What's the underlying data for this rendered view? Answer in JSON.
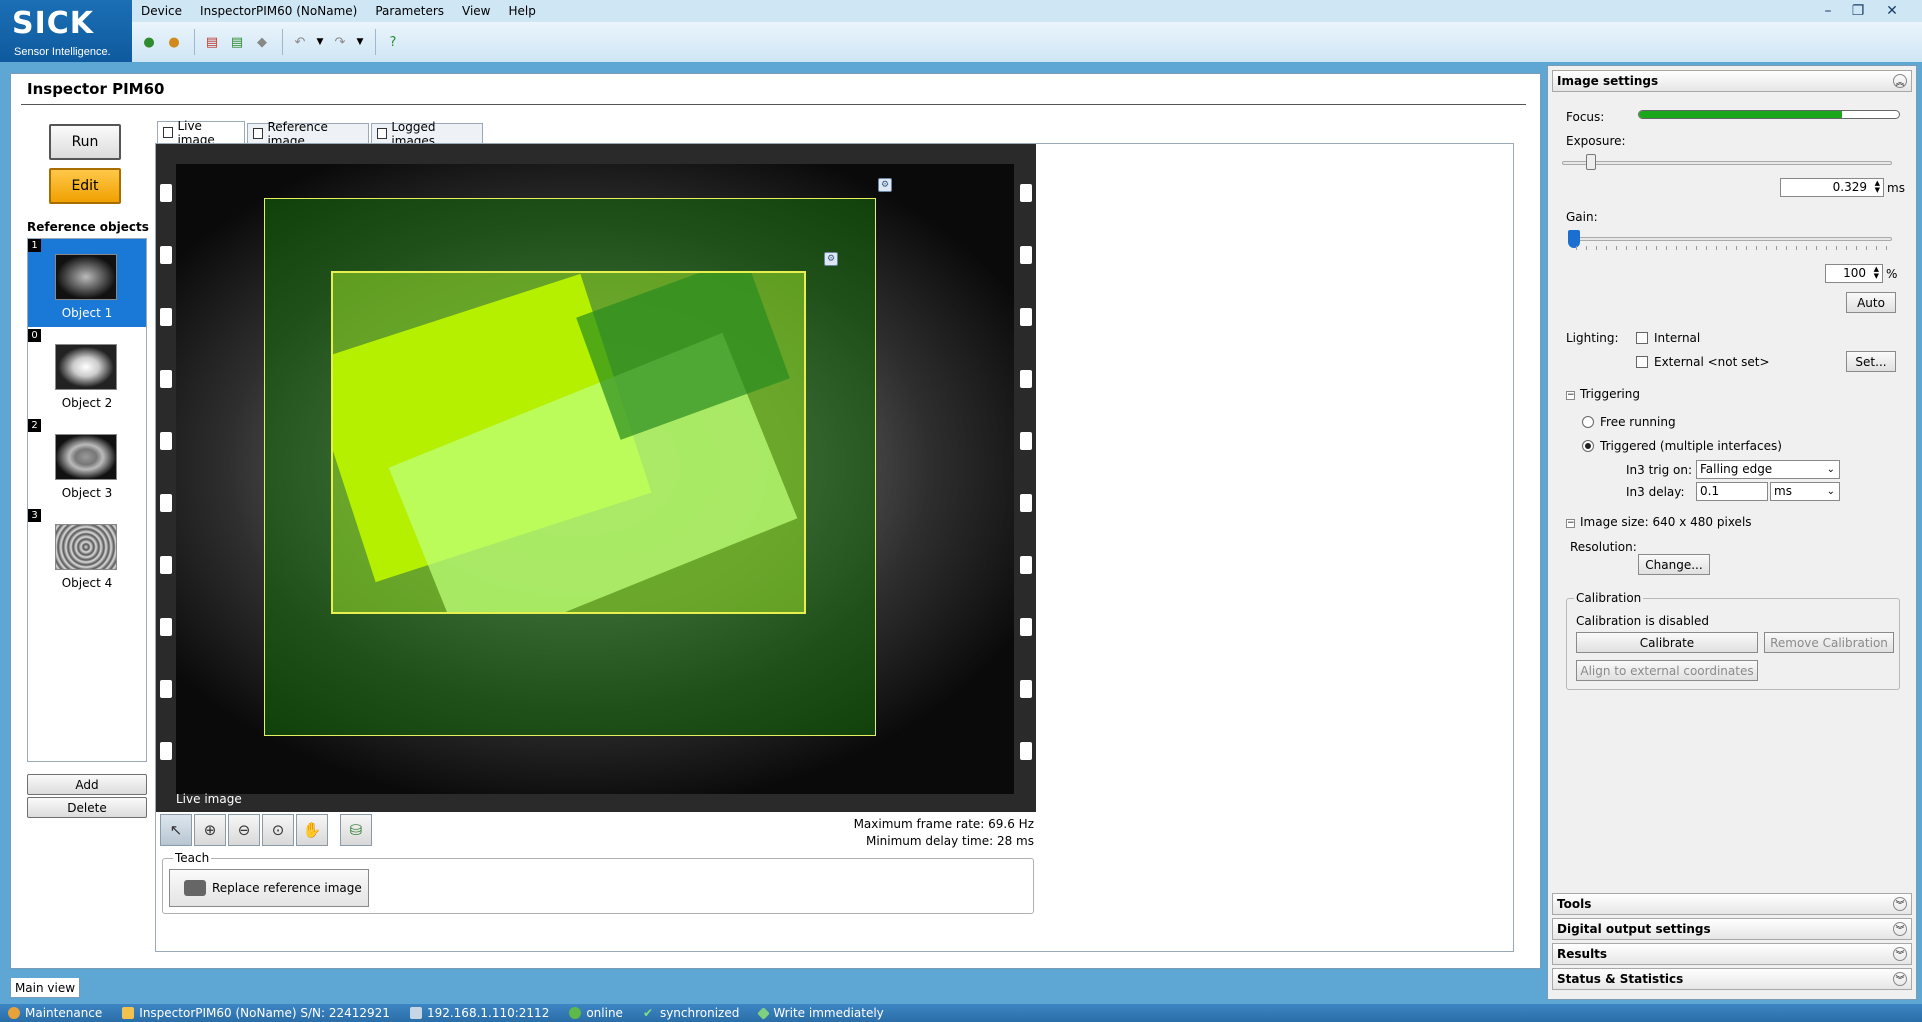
{
  "logo": {
    "brand": "SICK",
    "tagline": "Sensor Intelligence."
  },
  "menu": {
    "items": [
      "Device",
      "InspectorPIM60 (NoName)",
      "Parameters",
      "View",
      "Help"
    ]
  },
  "toolbar": {
    "icons": [
      "connect-icon",
      "disconnect-icon",
      "save-icon",
      "export-icon",
      "eraser-icon",
      "undo-icon",
      "dropdown-icon",
      "redo-icon",
      "dropdown-icon",
      "help-icon"
    ]
  },
  "window": {
    "minimize": "–",
    "restore": "❐",
    "close": "✕"
  },
  "main": {
    "title": "Inspector PIM60",
    "run_label": "Run",
    "edit_label": "Edit",
    "reference_header": "Reference objects",
    "objects": [
      {
        "num": "1",
        "label": "Object 1",
        "selected": true
      },
      {
        "num": "0",
        "label": "Object 2",
        "selected": false
      },
      {
        "num": "2",
        "label": "Object 3",
        "selected": false
      },
      {
        "num": "3",
        "label": "Object 4",
        "selected": false
      }
    ],
    "add_label": "Add",
    "delete_label": "Delete",
    "tabs": [
      "Live image",
      "Reference image",
      "Logged images"
    ],
    "image_caption": "Live image",
    "frame_rate": "Maximum frame rate: 69.6 Hz",
    "min_delay": "Minimum delay time: 28 ms",
    "teach_label": "Teach",
    "replace_label": "Replace reference image",
    "main_view_tab": "Main view"
  },
  "image_settings": {
    "header": "Image settings",
    "focus_label": "Focus:",
    "focus_level": 0.78,
    "exposure_label": "Exposure:",
    "exposure_value": "0.329",
    "exposure_unit": "ms",
    "gain_label": "Gain:",
    "gain_value": "100",
    "gain_unit": "%",
    "auto_label": "Auto",
    "lighting_label": "Lighting:",
    "internal_label": "Internal",
    "external_label": "External <not set>",
    "set_label": "Set...",
    "triggering_label": "Triggering",
    "free_running_label": "Free running",
    "triggered_label": "Triggered (multiple interfaces)",
    "trig_on_label": "In3 trig on:",
    "trig_on_value": "Falling edge",
    "delay_label": "In3 delay:",
    "delay_value": "0.1",
    "delay_unit": "ms",
    "image_size_label": "Image size: 640 x 480 pixels",
    "resolution_label": "Resolution:",
    "change_label": "Change...",
    "calibration_group": "Calibration",
    "calibration_status": "Calibration is disabled",
    "calibrate_label": "Calibrate",
    "remove_calibration_label": "Remove Calibration",
    "align_label": "Align to external coordinates"
  },
  "collapsed_sections": [
    "Tools",
    "Digital output settings",
    "Results",
    "Status & Statistics"
  ],
  "status": {
    "mode": "Maintenance",
    "device": "InspectorPIM60 (NoName) S/N: 22412921",
    "address": "192.168.1.110:2112",
    "online": "online",
    "sync": "synchronized",
    "write": "Write immediately"
  }
}
